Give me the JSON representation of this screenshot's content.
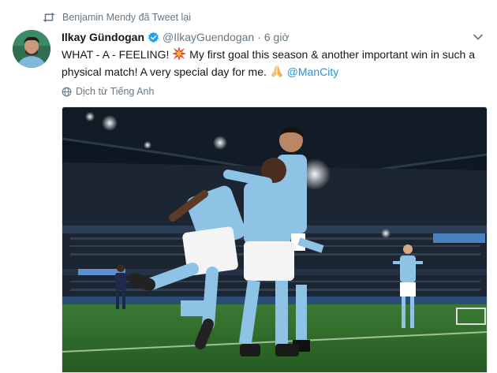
{
  "retweet": {
    "label": "Benjamin Mendy đã Tweet lại",
    "icon": "retweet-icon"
  },
  "tweet": {
    "author_name": "Ilkay Gündogan",
    "handle": "@IlkayGuendogan",
    "separator": "·",
    "time": "6 giờ",
    "text_part1": "WHAT - A - FEELING! ",
    "text_part2": " My first goal this season & another important win in such a physical match! A very special day for me. ",
    "text_part3": " ",
    "mention": "@ManCity",
    "emoji_1": "collision-emoji",
    "emoji_2": "folded-hands-emoji"
  },
  "translate": {
    "label": "Dịch từ Tiếng Anh",
    "icon": "globe-icon"
  },
  "colors": {
    "accent": "#1b95e0",
    "secondary_text": "#657786",
    "pitch": "#2f6b2c",
    "kit_sky_blue": "#8ec3e6"
  }
}
